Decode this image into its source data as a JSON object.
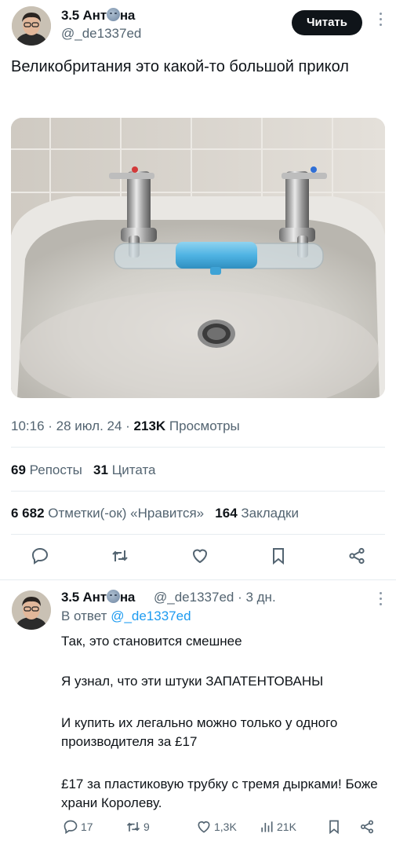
{
  "tweet": {
    "author_name_pre": "3.5 Ант",
    "author_name_post": "на",
    "handle": "@_de1337ed",
    "follow_label": "Читать",
    "text": "Великобритания это какой-то большой прикол",
    "time": "10:16 · 28 июл. 24 · ",
    "views_count": "213K",
    "views_label": "Просмотры",
    "reposts_count": "69",
    "reposts_label": "Репосты",
    "quotes_count": "31",
    "quotes_label": "Цитата",
    "likes_count": "6 682",
    "likes_label": "Отметки(-ок) «Нравится»",
    "bookmarks_count": "164",
    "bookmarks_label": "Закладки"
  },
  "reply": {
    "author_name_pre": "3.5 Ант",
    "author_name_post": "на",
    "handle_time": "@_de1337ed · 3 дн.",
    "reply_to_label": "В ответ",
    "reply_to_handle": "@_de1337ed",
    "paragraphs": [
      "Так, это становится смешнее",
      "Я узнал, что эти штуки ЗАПАТЕНТОВАНЫ",
      "И купить их легально можно только у одного производителя за £17",
      "£17 за пластиковую трубку с тремя дырками! Боже храни Королеву."
    ],
    "replies": "17",
    "reposts": "9",
    "likes": "1,3K",
    "views": "21K"
  },
  "colors": {
    "text": "#0f1419",
    "secondary": "#536471",
    "link": "#1d9bf0",
    "follow_bg": "#0f1419"
  }
}
